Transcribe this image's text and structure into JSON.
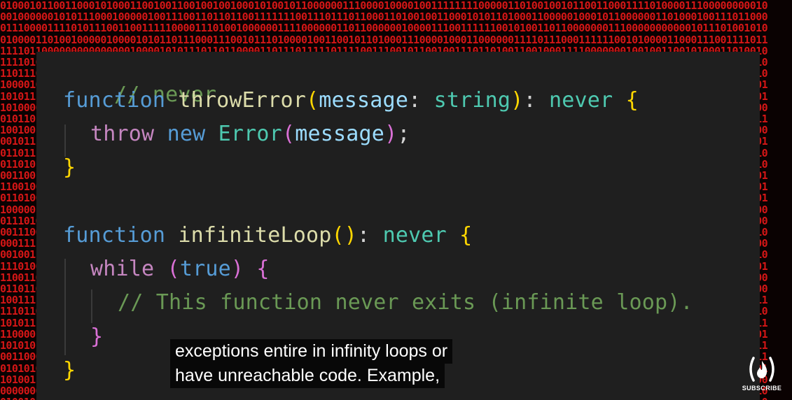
{
  "code": {
    "comment_never": "// never",
    "line2": {
      "kw": "function",
      "name": "throwError",
      "open": "(",
      "param": "message",
      "colon": ": ",
      "ptype": "string",
      "close": ")",
      "ret_colon": ": ",
      "ret": "never",
      "brace": "{"
    },
    "line3": {
      "kw_throw": "throw",
      "kw_new": "new",
      "cls": "Error",
      "open": "(",
      "arg": "message",
      "close": ")",
      "semi": ";"
    },
    "line4": {
      "brace": "}"
    },
    "line6": {
      "kw": "function",
      "name": "infiniteLoop",
      "parens": "()",
      "ret_colon": ": ",
      "ret": "never",
      "brace": "{"
    },
    "line7": {
      "kw": "while",
      "open": "(",
      "val": "true",
      "close": ")",
      "brace": "{"
    },
    "line8": {
      "comment": "// This function never exits (infinite loop)."
    },
    "line9": {
      "brace": "}"
    },
    "line10": {
      "brace": "}"
    }
  },
  "caption": {
    "line1": "exceptions entire in infinity loops or",
    "line2": "have unreachable code. Example,"
  },
  "logo": {
    "symbol": "(🔥)",
    "label": "SUBSCRIBE"
  },
  "colors": {
    "background_binary": "#e01818",
    "editor_bg": "#1f1f1f",
    "comment": "#6a9955",
    "keyword": "#569cd6",
    "function": "#dcdcaa"
  }
}
